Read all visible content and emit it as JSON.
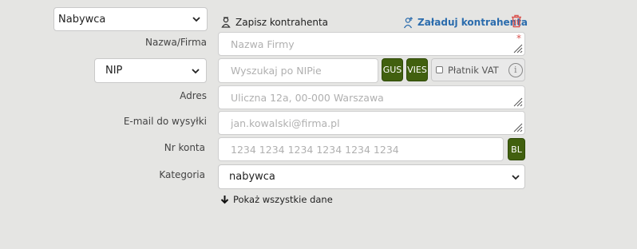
{
  "party_select": {
    "value": "Nabywca"
  },
  "save_contractor": {
    "label": "Zapisz kontrahenta"
  },
  "load_contractor": {
    "label": "Załaduj kontrahenta"
  },
  "fields": {
    "name": {
      "label": "Nazwa/Firma",
      "placeholder": "Nazwa Firmy",
      "required_mark": "*"
    },
    "nip": {
      "select_value": "NIP",
      "placeholder": "Wyszukaj po NIPie",
      "gus_label": "GUS",
      "vies_label": "VIES",
      "vat_label": "Płatnik VAT",
      "info_glyph": "i"
    },
    "address": {
      "label": "Adres",
      "placeholder": "Uliczna 12a, 00-000 Warszawa"
    },
    "email": {
      "label": "E-mail do wysyłki",
      "placeholder": "jan.kowalski@firma.pl"
    },
    "account": {
      "label": "Nr konta",
      "placeholder": "1234 1234 1234 1234 1234 1234",
      "bl_label": "BL"
    },
    "category": {
      "label": "Kategoria",
      "value": "nabywca"
    }
  },
  "show_all": {
    "label": "Pokaż wszystkie dane"
  },
  "colors": {
    "accent_green": "#41600f",
    "link_blue": "#2b6cad",
    "delete_red": "#d9534f"
  },
  "icons": [
    "chevron-down-icon",
    "person-icon",
    "person-upload-icon",
    "trash-icon",
    "resize-grip-icon",
    "info-icon",
    "arrow-down-icon"
  ]
}
